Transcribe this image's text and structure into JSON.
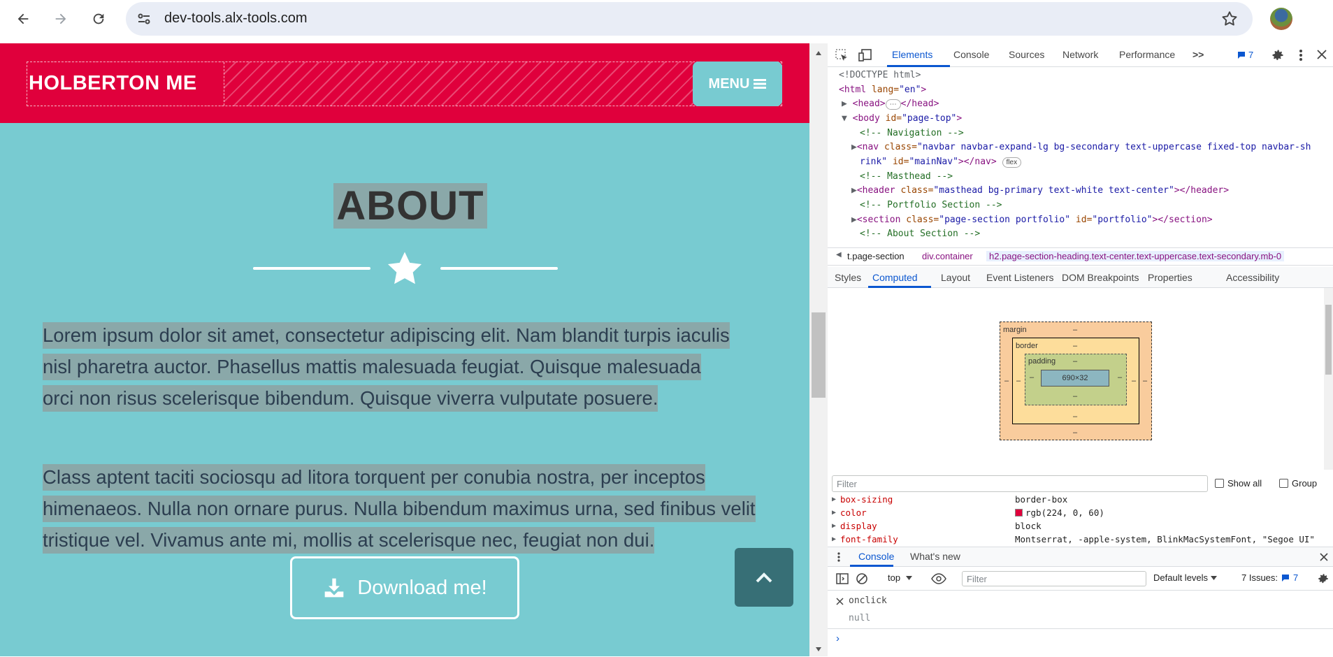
{
  "browser": {
    "url": "dev-tools.alx-tools.com"
  },
  "site": {
    "brand": "HOLBERTON ME",
    "menu_label": "MENU",
    "section_title": "ABOUT",
    "paragraph1": "Lorem ipsum dolor sit amet, consectetur adipiscing elit. Nam blandit turpis iaculis nisl pharetra auctor. Phasellus mattis malesuada feugiat. Quisque malesuada orci non risus scelerisque bibendum. Quisque viverra vulputate posuere.",
    "paragraph2": "Class aptent taciti sociosqu ad litora torquent per conubia nostra, per inceptos himenaeos. Nulla non ornare purus. Nulla bibendum maximus urna, sed finibus velit tristique vel. Vivamus ante mi, mollis at scelerisque nec, feugiat non dui.",
    "download_label": "Download me!",
    "colors": {
      "navbar": "#e0003c",
      "background": "#78cbd1",
      "highlight": "#8aa8a9"
    }
  },
  "devtools": {
    "tabs": [
      "Elements",
      "Console",
      "Sources",
      "Network",
      "Performance"
    ],
    "more_tabs": ">>",
    "issues_count": "7",
    "dom": {
      "doctype": "<!DOCTYPE html>",
      "html_open_tag": "<html ",
      "html_attr": "lang=",
      "html_val": "\"en\"",
      "html_close": ">",
      "head_open": "<head>",
      "head_close": "</head>",
      "body_open": "<body ",
      "body_attr": "id=",
      "body_val": "\"page-top\"",
      "body_close": ">",
      "c_nav": "<!-- Navigation -->",
      "nav_open": "<nav ",
      "nav_attr1": "class=",
      "nav_val1": "\"navbar navbar-expand-lg bg-secondary text-uppercase fixed-top navbar-sh",
      "nav_val1b": "rink\"",
      "nav_attr2": " id=",
      "nav_val2": "\"mainNav\"",
      "nav_close": "></nav>",
      "flex_badge": "flex",
      "c_masthead": "<!-- Masthead -->",
      "header_open": "<header ",
      "header_attr": "class=",
      "header_val": "\"masthead bg-primary text-white text-center\"",
      "header_close": "></header>",
      "c_portfolio": "<!-- Portfolio Section -->",
      "section1_open": "<section ",
      "section1_attr1": "class=",
      "section1_val1": "\"page-section portfolio\"",
      "section1_attr2": " id=",
      "section1_val2": "\"portfolio\"",
      "section1_close": "></section>",
      "c_about": "<!-- About Section -->"
    },
    "breadcrumbs": [
      "t.page-section",
      "div.container",
      "h2.page-section-heading.text-center.text-uppercase.text-secondary.mb-0"
    ],
    "subtabs": [
      "Styles",
      "Computed",
      "Layout",
      "Event Listeners",
      "DOM Breakpoints",
      "Properties",
      "Accessibility"
    ],
    "box_model": {
      "margin_label": "margin",
      "border_label": "border",
      "padding_label": "padding",
      "dash": "–",
      "content_size": "690×32"
    },
    "filter_placeholder": "Filter",
    "show_all_label": "Show all",
    "group_label": "Group",
    "computed_properties": [
      {
        "name": "box-sizing",
        "value": "border-box"
      },
      {
        "name": "color",
        "value": "rgb(224, 0, 60)",
        "swatch": "#e0003c"
      },
      {
        "name": "display",
        "value": "block"
      },
      {
        "name": "font-family",
        "value": "Montserrat, -apple-system, BlinkMacSystemFont, \"Segoe UI\""
      }
    ],
    "drawer_tabs": [
      "Console",
      "What's new"
    ],
    "console_context": "top",
    "console_filter_placeholder": "Filter",
    "log_levels": "Default levels",
    "issues_label": "7 Issues:",
    "console_entries": [
      {
        "input": "onclick",
        "output": "null"
      }
    ]
  }
}
